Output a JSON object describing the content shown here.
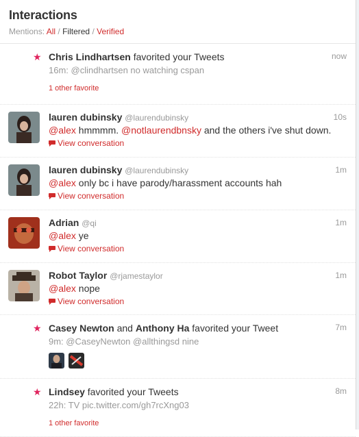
{
  "header": {
    "title": "Interactions",
    "filter_prefix": "Mentions:",
    "filter_all": "All",
    "filter_filtered": "Filtered",
    "filter_verified": "Verified",
    "separator": "/"
  },
  "items": [
    {
      "actor": "Chris Lindhartsen",
      "action": "favorited your Tweets",
      "time": "now",
      "detail": "16m: @clindhartsen no watching cspan",
      "footer": "1 other favorite"
    },
    {
      "name": "lauren dubinsky",
      "handle": "@laurendubinsky",
      "time": "10s",
      "mention1": "@alex",
      "text1": "hmmmm.",
      "mention2": "@notlaurendbnsky",
      "text2": "and the others i've shut down.",
      "link": "View conversation"
    },
    {
      "name": "lauren dubinsky",
      "handle": "@laurendubinsky",
      "time": "1m",
      "mention": "@alex",
      "text": "only bc i have parody/harassment accounts hah",
      "link": "View conversation"
    },
    {
      "name": "Adrian",
      "handle": "@qi",
      "time": "1m",
      "mention": "@alex",
      "text": "ye",
      "link": "View conversation"
    },
    {
      "name": "Robot Taylor",
      "handle": "@rjamestaylor",
      "time": "1m",
      "mention": "@alex",
      "text": "nope",
      "link": "View conversation"
    },
    {
      "actor1": "Casey Newton",
      "conj": "and",
      "actor2": "Anthony Ha",
      "action": "favorited your Tweet",
      "time": "7m",
      "detail": "9m: @CaseyNewton @allthingsd nine"
    },
    {
      "actor": "Lindsey",
      "action": "favorited your Tweets",
      "time": "8m",
      "detail": "22h: TV pic.twitter.com/gh7rcXng03",
      "footer": "1 other favorite"
    }
  ],
  "colors": {
    "accent": "#d02b2b",
    "star": "#e0245e",
    "muted": "#999999",
    "text": "#333333"
  },
  "icons": {
    "star": "star-icon",
    "bubble": "speech-bubble-icon"
  }
}
